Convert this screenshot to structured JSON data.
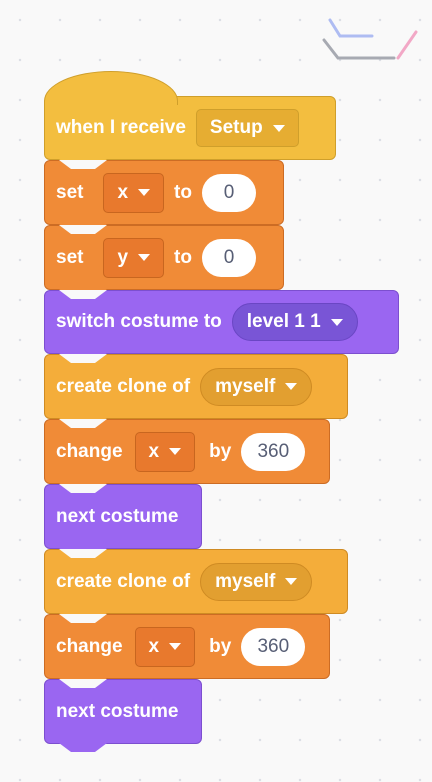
{
  "script": {
    "hat": {
      "label": "when I receive",
      "message": "Setup"
    },
    "set_x": {
      "label": "set",
      "variable": "x",
      "to": "to",
      "value": "0"
    },
    "set_y": {
      "label": "set",
      "variable": "y",
      "to": "to",
      "value": "0"
    },
    "switch_costume": {
      "label": "switch costume to",
      "costume": "level 1 1"
    },
    "clone_1": {
      "label": "create clone of",
      "target": "myself"
    },
    "change_x_1": {
      "label": "change",
      "variable": "x",
      "by": "by",
      "value": "360"
    },
    "next_costume_1": {
      "label": "next costume"
    },
    "clone_2": {
      "label": "create clone of",
      "target": "myself"
    },
    "change_x_2": {
      "label": "change",
      "variable": "x",
      "by": "by",
      "value": "360"
    },
    "next_costume_2": {
      "label": "next costume"
    }
  },
  "colors": {
    "events": "#f3be3f",
    "variables": "#f08b37",
    "looks": "#9a66f1",
    "control": "#f4ad3a",
    "canvas": "#f9f9f9"
  },
  "icons": [
    "dropdown-caret-icon",
    "corner-decoration-icon"
  ]
}
